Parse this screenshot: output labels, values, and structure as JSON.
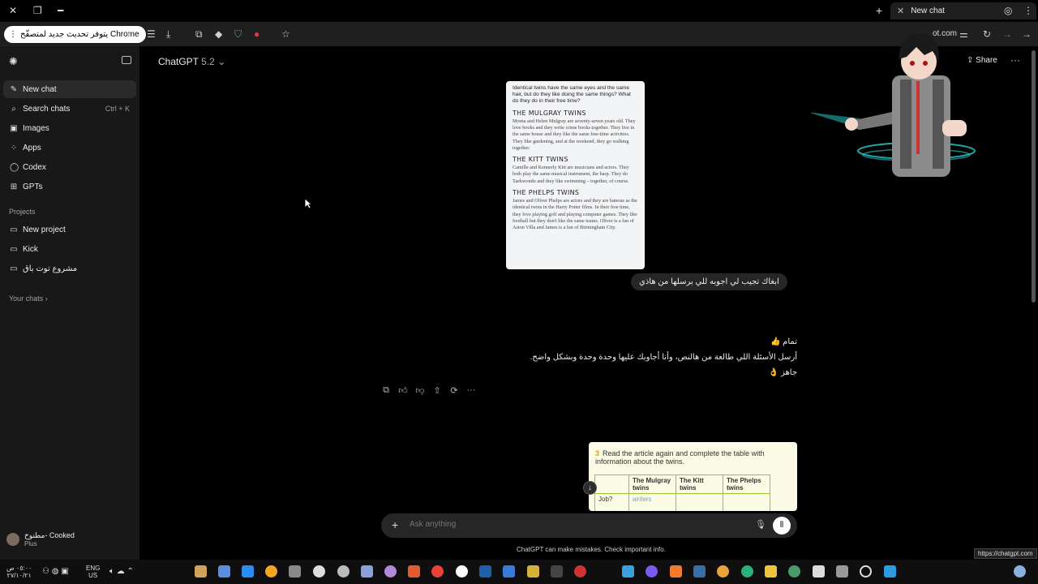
{
  "browser": {
    "tab_title": "New chat",
    "update_button": "يتوفر تحديث جديد لمتصفّح Chrome",
    "url_fragment": "ot.com",
    "url_tooltip": "https://chatgpt.com"
  },
  "sidebar": {
    "items": [
      {
        "label": "New chat",
        "icon": "compose-icon"
      },
      {
        "label": "Search chats",
        "icon": "search-icon",
        "shortcut": "Ctrl + K"
      },
      {
        "label": "Images",
        "icon": "image-icon"
      },
      {
        "label": "Apps",
        "icon": "apps-icon"
      },
      {
        "label": "Codex",
        "icon": "codex-icon"
      },
      {
        "label": "GPTs",
        "icon": "gpts-icon"
      }
    ],
    "projects_heading": "Projects",
    "projects": [
      {
        "label": "New project",
        "icon": "new-folder-icon"
      },
      {
        "label": "Kick",
        "icon": "folder-icon"
      },
      {
        "label": "مشروع توت باق",
        "icon": "folder-icon"
      }
    ],
    "your_chats": "Your chats",
    "user": {
      "name": "مطنوخ- Cooked",
      "plan": "Plus"
    }
  },
  "header": {
    "model": "ChatGPT",
    "version": "5.2",
    "share": "Share"
  },
  "conversation": {
    "article": {
      "intro": "Identical twins have the same eyes and the same hair, but do they like doing the same things? What do they do in their free time?",
      "sections": [
        {
          "heading": "THE MULGRAY TWINS",
          "body": "Morna and Helen Mulgray are seventy-seven years old. They love books and they write crime books together. They live in the same house and they like the same free-time activities. They like gardening, and at the weekend, they go walking together."
        },
        {
          "heading": "THE KITT TWINS",
          "body": "Camille and Kennerly Kitt are musicians and actors. They both play the same musical instrument, the harp. They do Taekwondo and they like swimming – together, of course."
        },
        {
          "heading": "THE PHELPS TWINS",
          "body": "James and Oliver Phelps are actors and they are famous as the identical twins in the Harry Potter films. In their free time, they love playing golf and playing computer games. They like football but they don't like the same teams. Oliver is a fan of Aston Villa and James is a fan of Birmingham City."
        }
      ]
    },
    "user_message": "ابغاك تجيب لي اجوبه للي برسلها من هاذي",
    "assistant_reply": [
      "تمام 👍",
      "أرسل الأسئلة اللي طالعة من هالنص، وأنا أجاوبك عليها وحدة وحدة وبشكل واضح.",
      "جاهز 👌"
    ],
    "action_icons": [
      "copy-icon",
      "thumbs-up-icon",
      "thumbs-down-icon",
      "share-icon",
      "regenerate-icon",
      "more-icon"
    ],
    "table_image": {
      "number": "3",
      "instruction": "Read the article again and complete the table with information about the twins.",
      "columns": [
        "",
        "The Mulgray twins",
        "The Kitt twins",
        "The Phelps twins"
      ],
      "row_label": "Job?",
      "row_values": [
        "writers",
        "",
        ""
      ]
    }
  },
  "composer": {
    "placeholder": "Ask anything",
    "disclaimer": "ChatGPT can make mistakes. Check important info."
  },
  "taskbar": {
    "time": "٠٥:٠٠ ص",
    "date": "٢٧/١٠/٢١",
    "lang": "ENG",
    "region": "US"
  }
}
